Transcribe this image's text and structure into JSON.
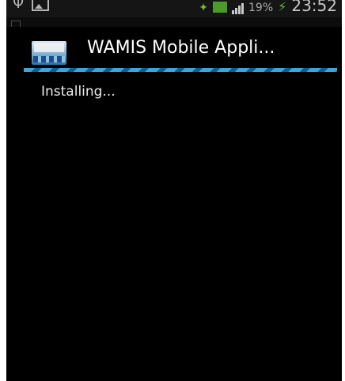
{
  "status_bar": {
    "battery_percent": "19%",
    "clock": "23:52",
    "left_icons": [
      "usb-icon",
      "gallery-icon"
    ],
    "right_icons": [
      "wifi-icon",
      "sync-icon",
      "signal-icon",
      "charging-icon"
    ]
  },
  "dialog": {
    "title": "WAMIS Mobile Appli...",
    "message": "Installing..."
  },
  "colors": {
    "background": "#000000",
    "accent": "#3aa7d8",
    "title_text": "#ffffff"
  }
}
